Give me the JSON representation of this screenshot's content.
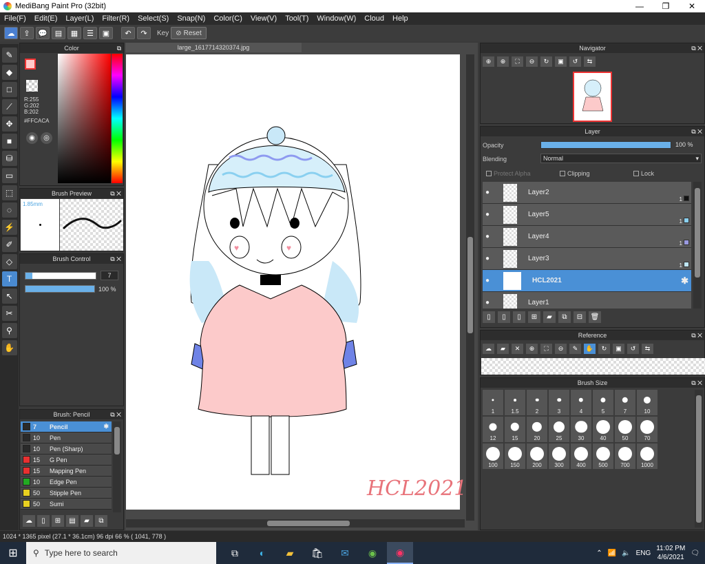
{
  "window": {
    "title": "MediBang Paint Pro (32bit)",
    "min": "—",
    "max": "❐",
    "close": "✕"
  },
  "menu": [
    "File(F)",
    "Edit(E)",
    "Layer(L)",
    "Filter(R)",
    "Select(S)",
    "Snap(N)",
    "Color(C)",
    "View(V)",
    "Tool(T)",
    "Window(W)",
    "Cloud",
    "Help"
  ],
  "toolbar": {
    "key_label": "Key",
    "reset_label": "Reset"
  },
  "color_panel": {
    "title": "Color",
    "r": "R:255",
    "g": "G:202",
    "b": "B:202",
    "hex": "#FFCACA"
  },
  "brush_preview": {
    "title": "Brush Preview",
    "size": "1.85mm"
  },
  "brush_control": {
    "title": "Brush Control",
    "size_value": "7",
    "opacity_value": "100 %",
    "size_frac": 0.1,
    "opacity_frac": 1.0
  },
  "brush_list": {
    "title": "Brush: Pencil",
    "items": [
      {
        "num": "7",
        "name": "Pencil",
        "color": "#2a2a2a",
        "selected": true
      },
      {
        "num": "10",
        "name": "Pen",
        "color": "#2a2a2a"
      },
      {
        "num": "10",
        "name": "Pen (Sharp)",
        "color": "#2a2a2a"
      },
      {
        "num": "15",
        "name": "G Pen",
        "color": "#e83030"
      },
      {
        "num": "15",
        "name": "Mapping Pen",
        "color": "#e83030"
      },
      {
        "num": "10",
        "name": "Edge Pen",
        "color": "#22aa22"
      },
      {
        "num": "50",
        "name": "Stipple Pen",
        "color": "#e8d020"
      },
      {
        "num": "50",
        "name": "Sumi",
        "color": "#e8d020"
      }
    ]
  },
  "canvas": {
    "tab": "large_1617714320374.jpg",
    "watermark": "HCL2021"
  },
  "navigator": {
    "title": "Navigator"
  },
  "layer_panel": {
    "title": "Layer",
    "opacity_label": "Opacity",
    "opacity_value": "100 %",
    "blending_label": "Blending",
    "blending_value": "Normal",
    "protect_alpha": "Protect Alpha",
    "clipping": "Clipping",
    "lock": "Lock",
    "layers": [
      {
        "name": "Layer2",
        "chip": "#111111",
        "num": "1"
      },
      {
        "name": "Layer5",
        "chip": "#8ad0f0",
        "num": "1"
      },
      {
        "name": "Layer4",
        "chip": "#9a9ae0",
        "num": "1"
      },
      {
        "name": "Layer3",
        "chip": "#bfe6f5",
        "num": "1"
      },
      {
        "name": "HCL2021",
        "selected": true
      },
      {
        "name": "Layer1"
      }
    ]
  },
  "reference": {
    "title": "Reference"
  },
  "brush_size": {
    "title": "Brush Size",
    "sizes": [
      "1",
      "1.5",
      "2",
      "3",
      "4",
      "5",
      "7",
      "10",
      "12",
      "15",
      "20",
      "25",
      "30",
      "40",
      "50",
      "70",
      "100",
      "150",
      "200",
      "300",
      "400",
      "500",
      "700",
      "1000"
    ]
  },
  "status": "1024 * 1365 pixel   (27.1 * 36.1cm)   96 dpi   66 %   ( 1041, 778 )",
  "taskbar": {
    "search_placeholder": "Type here to search",
    "lang": "ENG",
    "time": "11:02 PM",
    "date": "4/6/2021"
  }
}
